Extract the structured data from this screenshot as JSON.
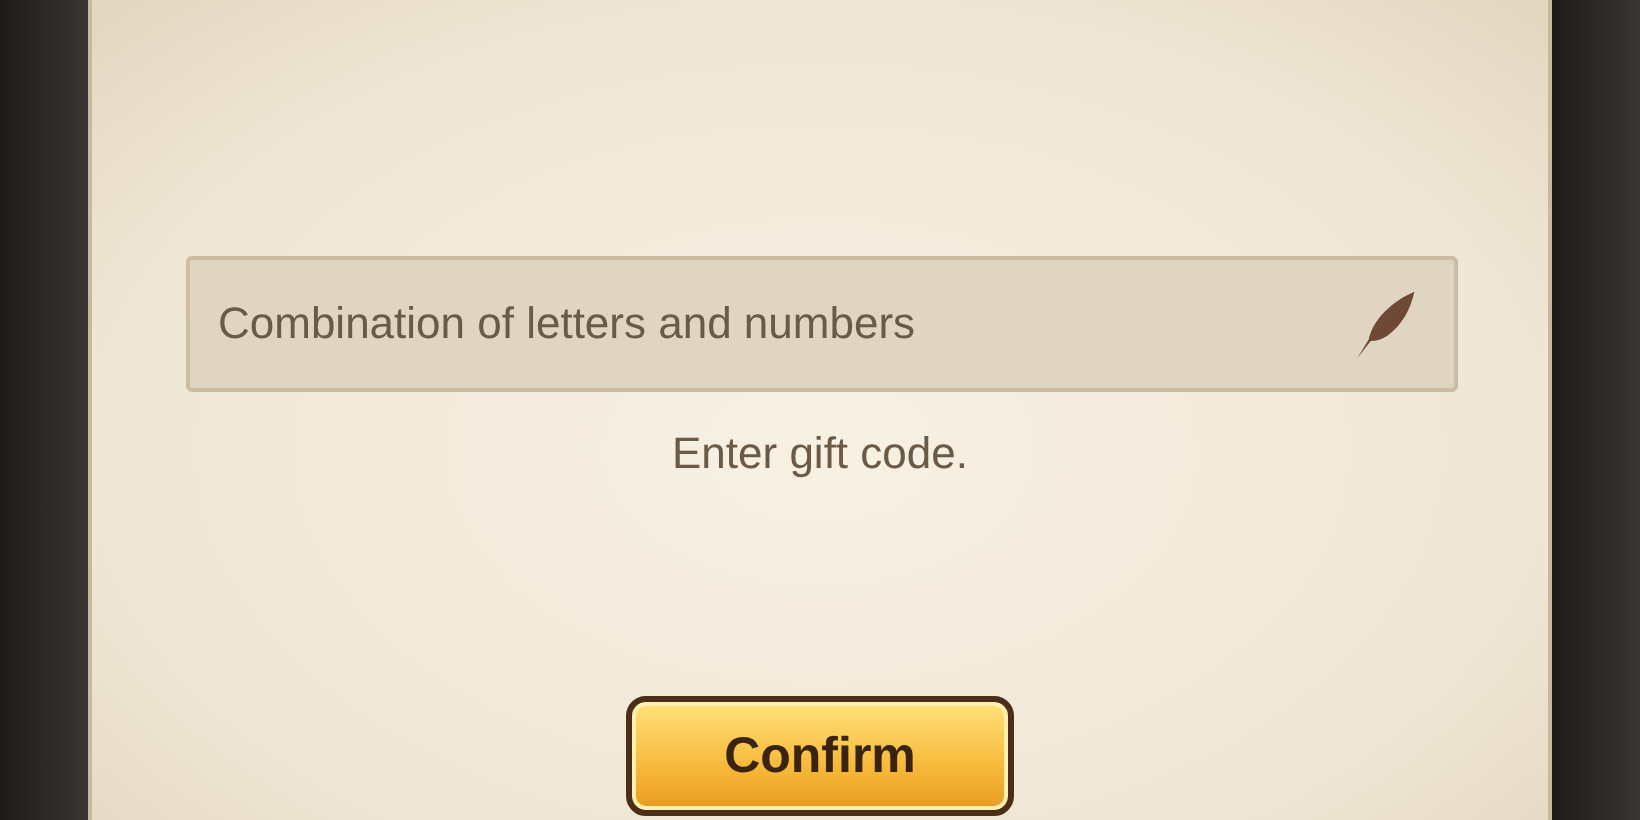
{
  "gift_code_field": {
    "placeholder": "Combination of letters and numbers"
  },
  "hint": "Enter gift code.",
  "confirm_button": {
    "label": "Confirm"
  }
}
